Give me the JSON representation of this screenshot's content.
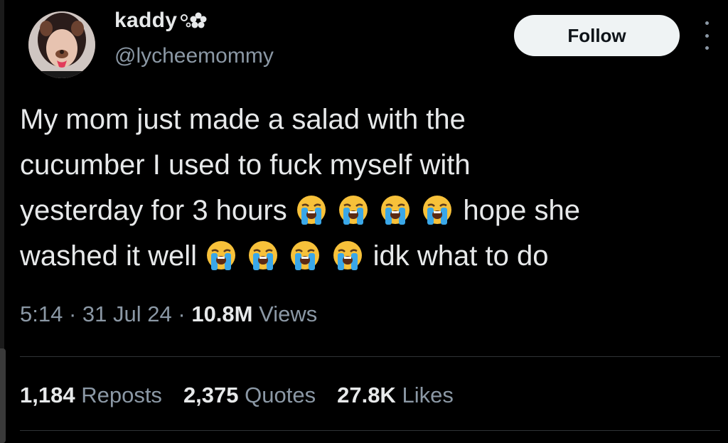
{
  "author": {
    "display_name": "kaddy",
    "handle": "@lycheemommy"
  },
  "follow_label": "Follow",
  "tweet": {
    "line1": "My mom just made a salad with the",
    "line2": "cucumber I used to fuck myself with",
    "line3a": "yesterday for 3 hours",
    "line3b": "hope she",
    "line4a": "washed it well",
    "line4b": "idk what to do"
  },
  "meta": {
    "time": "5:14",
    "sep1": "·",
    "date": "31 Jul 24",
    "sep2": "·",
    "views_count": "10.8M",
    "views_label": "Views"
  },
  "stats": {
    "reposts_count": "1,184",
    "reposts_label": "Reposts",
    "quotes_count": "2,375",
    "quotes_label": "Quotes",
    "likes_count": "27.8K",
    "likes_label": "Likes"
  }
}
